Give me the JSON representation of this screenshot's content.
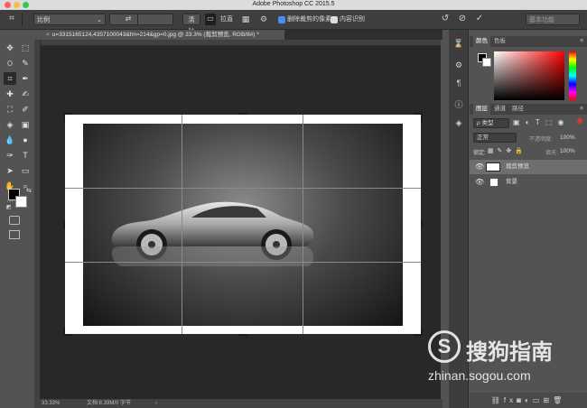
{
  "window": {
    "title": "Adobe Photoshop CC 2015.5"
  },
  "options_bar": {
    "ratio_select": "比例",
    "clear_button": "清除",
    "straighten_button": "拉直",
    "delete_cropped_label": "删除裁剪的像素",
    "content_aware_label": "内容识别",
    "workspace_select": "基本功能",
    "delete_cropped_checked": true,
    "content_aware_checked": false
  },
  "document": {
    "tab_title": "u=3315165124,4357100043&fm=214&gp=0.jpg @ 33.3% (裁剪预览, RGB/8#) *"
  },
  "status": {
    "zoom": "33.33%",
    "doc_info": "文档:8.39M/0 字节"
  },
  "color_panel": {
    "tabs": [
      "颜色",
      "色板"
    ],
    "active_tab": "颜色"
  },
  "layers_panel": {
    "tabs": [
      "图层",
      "通道",
      "路径"
    ],
    "active_tab": "图层",
    "filter_select": "ρ 类型",
    "blend_mode": "正常",
    "opacity_label": "不透明度:",
    "opacity_value": "100%",
    "lock_label": "锁定:",
    "fill_label": "填充:",
    "fill_value": "100%",
    "layers": [
      {
        "name": "裁剪预览",
        "selected": true
      },
      {
        "name": "背景",
        "selected": false
      }
    ]
  },
  "watermark": {
    "brand": "搜狗指南",
    "url": "zhinan.sogou.com"
  },
  "colors": {
    "accent_red": "#ff0000",
    "panel_bg": "#535353",
    "canvas_bg": "#282828"
  }
}
